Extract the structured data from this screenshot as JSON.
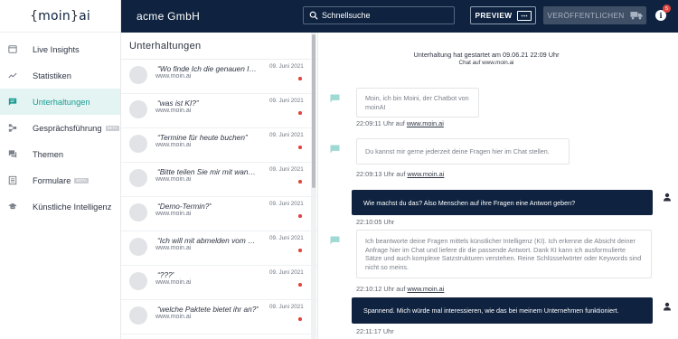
{
  "logo": {
    "open": "{",
    "text": "moin",
    "close": "}",
    "suffix": "ai"
  },
  "sidebar": {
    "items": [
      {
        "label": "Live Insights",
        "icon": "window-icon",
        "active": false,
        "beta": ""
      },
      {
        "label": "Statistiken",
        "icon": "trend-icon",
        "active": false,
        "beta": ""
      },
      {
        "label": "Unterhaltungen",
        "icon": "chat-icon",
        "active": true,
        "beta": ""
      },
      {
        "label": "Gesprächsführung",
        "icon": "flow-icon",
        "active": false,
        "beta": "BETA"
      },
      {
        "label": "Themen",
        "icon": "topics-icon",
        "active": false,
        "beta": ""
      },
      {
        "label": "Formulare",
        "icon": "form-icon",
        "active": false,
        "beta": "BETA"
      },
      {
        "label": "Künstliche Intelligenz",
        "icon": "graduation-cap-icon",
        "active": false,
        "beta": ""
      }
    ]
  },
  "topbar": {
    "company": "acme GmbH",
    "search_placeholder": "Schnellsuche",
    "preview_label": "PREVIEW",
    "publish_label": "VERÖFFENTLICHEN",
    "notification_count": "5",
    "info_label": "i"
  },
  "conversations": {
    "title": "Unterhaltungen",
    "items": [
      {
        "question": "“Wo finde Ich die genauen Inf…",
        "site": "www.moin.ai",
        "date": "09. Juni 2021"
      },
      {
        "question": "“was ist KI?”",
        "site": "www.moin.ai",
        "date": "09. Juni 2021"
      },
      {
        "question": "“Termine für heute buchen”",
        "site": "www.moin.ai",
        "date": "09. Juni 2021"
      },
      {
        "question": "“Bitte teilen Sie mir mit wann…",
        "site": "www.moin.ai",
        "date": "09. Juni 2021"
      },
      {
        "question": "“Demo-Termin?”",
        "site": "www.moin.ai",
        "date": "09. Juni 2021"
      },
      {
        "question": "“Ich will mit abmelden vom N…",
        "site": "www.moin.ai",
        "date": "09. Juni 2021"
      },
      {
        "question": "“???”",
        "site": "www.moin.ai",
        "date": "09. Juni 2021"
      },
      {
        "question": "“welche Paktete bietet ihr an?”",
        "site": "www.moin.ai",
        "date": "09. Juni 2021"
      }
    ]
  },
  "chat": {
    "started": "Unterhaltung hat gestartet am 09.06.21 22:09 Uhr",
    "channel": "Chat auf www.moin.ai",
    "messages": [
      {
        "from": "bot",
        "text": "Moin, ich bin Moini, der Chatbot von moinAI",
        "time": "22:09:11 Uhr auf",
        "link": "www.moin.ai"
      },
      {
        "from": "bot",
        "text": "Du kannst mir gerne jederzeit deine Fragen hier im Chat stellen.",
        "time": "22:09:13 Uhr auf",
        "link": "www.moin.ai"
      },
      {
        "from": "user",
        "text": "Wie machst du das? Also Menschen auf ihre Fragen eine Antwort geben?",
        "time": "22:10:05 Uhr"
      },
      {
        "from": "bot",
        "text": "Ich beantworte deine Fragen mittels künstlicher Intelligenz (KI). Ich erkenne die Absicht deiner Anfrage hier im Chat und liefere dir die passende Antwort. Dank KI kann ich ausformulierte Sätze und auch komplexe Satzstrukturen verstehen. Reine Schlüsselwörter oder Keywords sind nicht so meins.",
        "time": "22:10:12 Uhr auf",
        "link": "www.moin.ai"
      },
      {
        "from": "user",
        "text": "Spannend. Mich würde mal interessieren, wie das bei meinem Unternehmen funktioniert.",
        "time": "22:11:17 Uhr"
      }
    ]
  },
  "colors": {
    "navy": "#0f2340",
    "accent": "#1b9c92",
    "active_bg": "#e4f4f3",
    "unread": "#e0453f"
  }
}
